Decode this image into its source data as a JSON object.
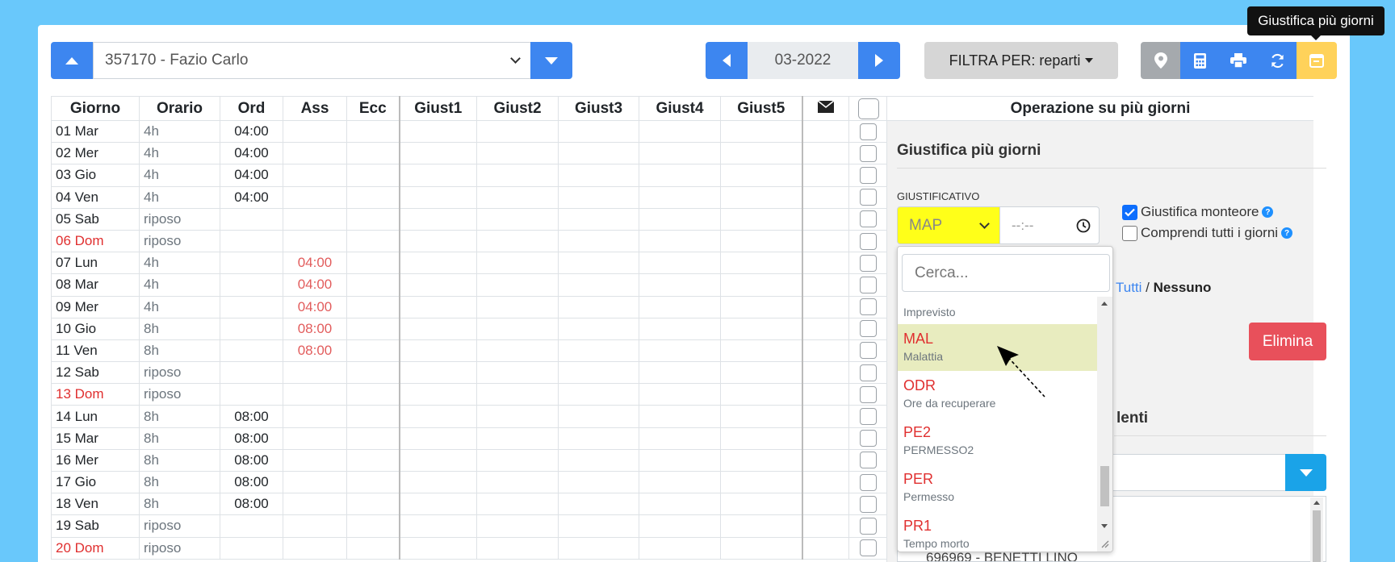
{
  "employee_select": {
    "value": "357170 - Fazio Carlo"
  },
  "period": {
    "value": "03-2022"
  },
  "filter": {
    "label": "FILTRA PER: reparti"
  },
  "tooltip": {
    "text": "Giustifica più giorni"
  },
  "colors": {
    "primary": "#3d86f0",
    "warning": "#ffd25a",
    "danger": "#e8505b",
    "highlight": "#ffff19",
    "active_item": "#e8ecbf"
  },
  "table": {
    "headers": [
      "Giorno",
      "Orario",
      "Ord",
      "Ass",
      "Ecc",
      "Giust1",
      "Giust2",
      "Giust3",
      "Giust4",
      "Giust5"
    ],
    "rows": [
      {
        "giorno": "01 Mar",
        "orario": "4h",
        "ord": "04:00",
        "ass": ""
      },
      {
        "giorno": "02 Mer",
        "orario": "4h",
        "ord": "04:00",
        "ass": ""
      },
      {
        "giorno": "03 Gio",
        "orario": "4h",
        "ord": "04:00",
        "ass": ""
      },
      {
        "giorno": "04 Ven",
        "orario": "4h",
        "ord": "04:00",
        "ass": ""
      },
      {
        "giorno": "05 Sab",
        "orario": "riposo",
        "ord": "",
        "ass": ""
      },
      {
        "giorno": "06 Dom",
        "orario": "riposo",
        "ord": "",
        "ass": ""
      },
      {
        "giorno": "07 Lun",
        "orario": "4h",
        "ord": "",
        "ass": "04:00"
      },
      {
        "giorno": "08 Mar",
        "orario": "4h",
        "ord": "",
        "ass": "04:00"
      },
      {
        "giorno": "09 Mer",
        "orario": "4h",
        "ord": "",
        "ass": "04:00"
      },
      {
        "giorno": "10 Gio",
        "orario": "8h",
        "ord": "",
        "ass": "08:00"
      },
      {
        "giorno": "11 Ven",
        "orario": "8h",
        "ord": "",
        "ass": "08:00"
      },
      {
        "giorno": "12 Sab",
        "orario": "riposo",
        "ord": "",
        "ass": ""
      },
      {
        "giorno": "13 Dom",
        "orario": "riposo",
        "ord": "",
        "ass": ""
      },
      {
        "giorno": "14 Lun",
        "orario": "8h",
        "ord": "08:00",
        "ass": ""
      },
      {
        "giorno": "15 Mar",
        "orario": "8h",
        "ord": "08:00",
        "ass": ""
      },
      {
        "giorno": "16 Mer",
        "orario": "8h",
        "ord": "08:00",
        "ass": ""
      },
      {
        "giorno": "17 Gio",
        "orario": "8h",
        "ord": "08:00",
        "ass": ""
      },
      {
        "giorno": "18 Ven",
        "orario": "8h",
        "ord": "08:00",
        "ass": ""
      },
      {
        "giorno": "19 Sab",
        "orario": "riposo",
        "ord": "",
        "ass": ""
      },
      {
        "giorno": "20 Dom",
        "orario": "riposo",
        "ord": "",
        "ass": ""
      }
    ],
    "sunday_rows": [
      5,
      12,
      19
    ]
  },
  "panel": {
    "header": "Operazione su più giorni",
    "title": "Giustifica più giorni",
    "giustificativo_label": "GIUSTIFICATIVO",
    "giustificativo_value": "MAP",
    "time_placeholder": "--:--",
    "check_monteore": "Giustifica monteore",
    "check_monteore_checked": true,
    "check_tutti": "Comprendi tutti i giorni",
    "check_tutti_checked": false,
    "tutti": "Tutti",
    "sep": "/",
    "nessuno": "Nessuno",
    "elimina": "Elimina",
    "section2_title_partial": "lenti",
    "list_partial": "696969 - BENETTI LINO"
  },
  "dropdown": {
    "search_placeholder": "Cerca...",
    "partial_top": "Imprevisto",
    "items": [
      {
        "code": "MAL",
        "desc": "Malattia",
        "active": true
      },
      {
        "code": "ODR",
        "desc": "Ore da recuperare"
      },
      {
        "code": "PE2",
        "desc": "PERMESSO2"
      },
      {
        "code": "PER",
        "desc": "Permesso"
      },
      {
        "code": "PR1",
        "desc": "Tempo morto"
      }
    ]
  }
}
